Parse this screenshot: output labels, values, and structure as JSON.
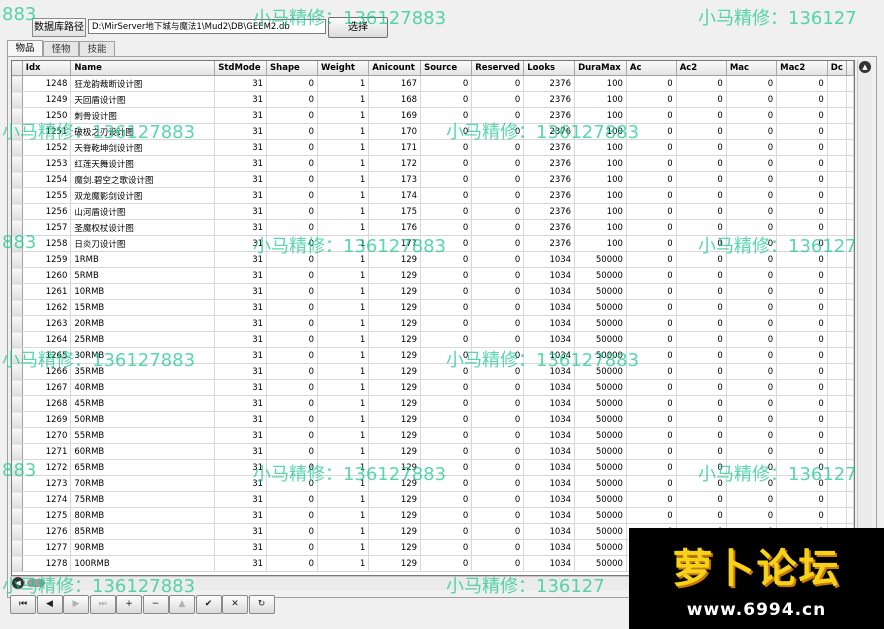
{
  "toolbar": {
    "path_label": "数据库路径",
    "path_value": "D:\\MirServer地下城与魔法1\\Mud2\\DB\\GEEM2.db",
    "select_label": "选择"
  },
  "tabs": [
    "物品",
    "怪物",
    "技能"
  ],
  "columns": [
    "Idx",
    "Name",
    "StdMode",
    "Shape",
    "Weight",
    "Anicount",
    "Source",
    "Reserved",
    "Looks",
    "DuraMax",
    "Ac",
    "Ac2",
    "Mac",
    "Mac2",
    "Dc"
  ],
  "rows": [
    [
      "1248",
      "狂龙韵裁断设计图",
      "31",
      "0",
      "1",
      "167",
      "0",
      "0",
      "2376",
      "100",
      "0",
      "0",
      "0",
      "0"
    ],
    [
      "1249",
      "天回盾设计图",
      "31",
      "0",
      "1",
      "168",
      "0",
      "0",
      "2376",
      "100",
      "0",
      "0",
      "0",
      "0"
    ],
    [
      "1250",
      "刺骨设计图",
      "31",
      "0",
      "1",
      "169",
      "0",
      "0",
      "2376",
      "100",
      "0",
      "0",
      "0",
      "0"
    ],
    [
      "1251",
      "破极之刃设计图",
      "31",
      "0",
      "1",
      "170",
      "0",
      "0",
      "2376",
      "100",
      "0",
      "0",
      "0",
      "0"
    ],
    [
      "1252",
      "天脊乾坤剑设计图",
      "31",
      "0",
      "1",
      "171",
      "0",
      "0",
      "2376",
      "100",
      "0",
      "0",
      "0",
      "0"
    ],
    [
      "1253",
      "红莲天舞设计图",
      "31",
      "0",
      "1",
      "172",
      "0",
      "0",
      "2376",
      "100",
      "0",
      "0",
      "0",
      "0"
    ],
    [
      "1254",
      "魔剑.碧空之歌设计图",
      "31",
      "0",
      "1",
      "173",
      "0",
      "0",
      "2376",
      "100",
      "0",
      "0",
      "0",
      "0"
    ],
    [
      "1255",
      "双龙魔影剑设计图",
      "31",
      "0",
      "1",
      "174",
      "0",
      "0",
      "2376",
      "100",
      "0",
      "0",
      "0",
      "0"
    ],
    [
      "1256",
      "山河盾设计图",
      "31",
      "0",
      "1",
      "175",
      "0",
      "0",
      "2376",
      "100",
      "0",
      "0",
      "0",
      "0"
    ],
    [
      "1257",
      "圣魔权杖设计图",
      "31",
      "0",
      "1",
      "176",
      "0",
      "0",
      "2376",
      "100",
      "0",
      "0",
      "0",
      "0"
    ],
    [
      "1258",
      "日炎刀设计图",
      "31",
      "0",
      "1",
      "177",
      "0",
      "0",
      "2376",
      "100",
      "0",
      "0",
      "0",
      "0"
    ],
    [
      "1259",
      "1RMB",
      "31",
      "0",
      "1",
      "129",
      "0",
      "0",
      "1034",
      "50000",
      "0",
      "0",
      "0",
      "0"
    ],
    [
      "1260",
      "5RMB",
      "31",
      "0",
      "1",
      "129",
      "0",
      "0",
      "1034",
      "50000",
      "0",
      "0",
      "0",
      "0"
    ],
    [
      "1261",
      "10RMB",
      "31",
      "0",
      "1",
      "129",
      "0",
      "0",
      "1034",
      "50000",
      "0",
      "0",
      "0",
      "0"
    ],
    [
      "1262",
      "15RMB",
      "31",
      "0",
      "1",
      "129",
      "0",
      "0",
      "1034",
      "50000",
      "0",
      "0",
      "0",
      "0"
    ],
    [
      "1263",
      "20RMB",
      "31",
      "0",
      "1",
      "129",
      "0",
      "0",
      "1034",
      "50000",
      "0",
      "0",
      "0",
      "0"
    ],
    [
      "1264",
      "25RMB",
      "31",
      "0",
      "1",
      "129",
      "0",
      "0",
      "1034",
      "50000",
      "0",
      "0",
      "0",
      "0"
    ],
    [
      "1265",
      "30RMB",
      "31",
      "0",
      "1",
      "129",
      "0",
      "0",
      "1034",
      "50000",
      "0",
      "0",
      "0",
      "0"
    ],
    [
      "1266",
      "35RMB",
      "31",
      "0",
      "1",
      "129",
      "0",
      "0",
      "1034",
      "50000",
      "0",
      "0",
      "0",
      "0"
    ],
    [
      "1267",
      "40RMB",
      "31",
      "0",
      "1",
      "129",
      "0",
      "0",
      "1034",
      "50000",
      "0",
      "0",
      "0",
      "0"
    ],
    [
      "1268",
      "45RMB",
      "31",
      "0",
      "1",
      "129",
      "0",
      "0",
      "1034",
      "50000",
      "0",
      "0",
      "0",
      "0"
    ],
    [
      "1269",
      "50RMB",
      "31",
      "0",
      "1",
      "129",
      "0",
      "0",
      "1034",
      "50000",
      "0",
      "0",
      "0",
      "0"
    ],
    [
      "1270",
      "55RMB",
      "31",
      "0",
      "1",
      "129",
      "0",
      "0",
      "1034",
      "50000",
      "0",
      "0",
      "0",
      "0"
    ],
    [
      "1271",
      "60RMB",
      "31",
      "0",
      "1",
      "129",
      "0",
      "0",
      "1034",
      "50000",
      "0",
      "0",
      "0",
      "0"
    ],
    [
      "1272",
      "65RMB",
      "31",
      "0",
      "1",
      "129",
      "0",
      "0",
      "1034",
      "50000",
      "0",
      "0",
      "0",
      "0"
    ],
    [
      "1273",
      "70RMB",
      "31",
      "0",
      "1",
      "129",
      "0",
      "0",
      "1034",
      "50000",
      "0",
      "0",
      "0",
      "0"
    ],
    [
      "1274",
      "75RMB",
      "31",
      "0",
      "1",
      "129",
      "0",
      "0",
      "1034",
      "50000",
      "0",
      "0",
      "0",
      "0"
    ],
    [
      "1275",
      "80RMB",
      "31",
      "0",
      "1",
      "129",
      "0",
      "0",
      "1034",
      "50000",
      "0",
      "0",
      "0",
      "0"
    ],
    [
      "1276",
      "85RMB",
      "31",
      "0",
      "1",
      "129",
      "0",
      "0",
      "1034",
      "50000",
      "0",
      "0",
      "0",
      "0"
    ],
    [
      "1277",
      "90RMB",
      "31",
      "0",
      "1",
      "129",
      "0",
      "0",
      "1034",
      "50000",
      "0",
      "0",
      "0",
      "0"
    ],
    [
      "1278",
      "100RMB",
      "31",
      "0",
      "1",
      "129",
      "0",
      "0",
      "1034",
      "50000",
      "0",
      "0",
      "0",
      "0"
    ]
  ],
  "navigator": [
    "⏮",
    "◀",
    "▶",
    "⏭",
    "+",
    "−",
    "▲",
    "✔",
    "✕",
    "↻"
  ],
  "navigator_icons": [
    "first-record-icon",
    "prior-record-icon",
    "next-record-icon",
    "last-record-icon",
    "insert-icon",
    "delete-icon",
    "edit-icon",
    "post-icon",
    "cancel-icon",
    "refresh-icon"
  ],
  "watermark": {
    "text_full": "小马精修：136127883",
    "text_right": "小马精修：136127",
    "text_left": "883",
    "color": "#18c88c"
  },
  "logo": {
    "title": "萝卜论坛",
    "url": "www.6994.cn"
  }
}
